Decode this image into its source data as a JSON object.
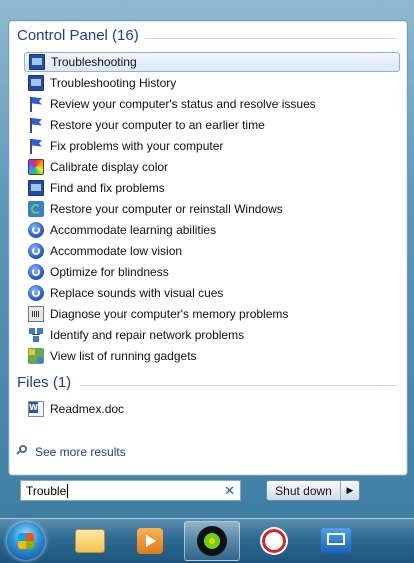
{
  "control_panel": {
    "heading": "Control Panel (16)",
    "items": [
      {
        "label": "Troubleshooting",
        "icon": "monitor-icon",
        "selected": true
      },
      {
        "label": "Troubleshooting History",
        "icon": "monitor-icon"
      },
      {
        "label": "Review your computer's status and resolve issues",
        "icon": "flag-icon"
      },
      {
        "label": "Restore your computer to an earlier time",
        "icon": "flag-icon"
      },
      {
        "label": "Fix problems with your computer",
        "icon": "flag-icon"
      },
      {
        "label": "Calibrate display color",
        "icon": "color-calibration-icon"
      },
      {
        "label": "Find and fix problems",
        "icon": "monitor-icon"
      },
      {
        "label": "Restore your computer or reinstall Windows",
        "icon": "restore-icon"
      },
      {
        "label": "Accommodate learning abilities",
        "icon": "ease-of-access-icon"
      },
      {
        "label": "Accommodate low vision",
        "icon": "ease-of-access-icon"
      },
      {
        "label": "Optimize for blindness",
        "icon": "ease-of-access-icon"
      },
      {
        "label": "Replace sounds with visual cues",
        "icon": "ease-of-access-icon"
      },
      {
        "label": "Diagnose your computer's memory problems",
        "icon": "memory-icon"
      },
      {
        "label": "Identify and repair network problems",
        "icon": "network-icon"
      },
      {
        "label": "View list of running gadgets",
        "icon": "gadgets-icon"
      }
    ]
  },
  "files": {
    "heading": "Files (1)",
    "items": [
      {
        "label": "Readmex.doc",
        "icon": "word-document-icon"
      }
    ]
  },
  "see_more": "See more results",
  "search": {
    "value": "Trouble"
  },
  "shutdown": {
    "label": "Shut down"
  },
  "taskbar": {
    "buttons": [
      {
        "name": "start-orb",
        "icon": "windows-orb-icon"
      },
      {
        "name": "explorer",
        "icon": "folder-icon"
      },
      {
        "name": "media-player",
        "icon": "media-player-icon"
      },
      {
        "name": "icq",
        "icon": "icq-flower-icon",
        "active": true
      },
      {
        "name": "snipping-tool",
        "icon": "snipping-tool-icon"
      },
      {
        "name": "remote-desktop",
        "icon": "remote-desktop-icon"
      }
    ]
  }
}
